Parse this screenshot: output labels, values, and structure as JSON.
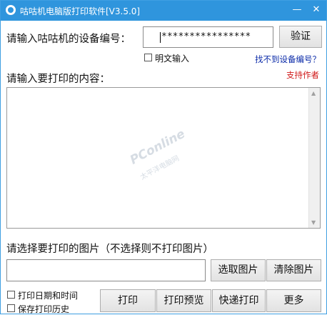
{
  "window": {
    "title": "咕咕机电脑版打印软件[V3.5.0]",
    "minimize_glyph": "—",
    "close_glyph": "✕"
  },
  "device": {
    "label": "请输入咕咕机的设备编号：",
    "value": "****************",
    "verify_label": "验证",
    "show_plain_label": "明文输入",
    "show_plain_checked": false,
    "not_found_link": "找不到设备编号？"
  },
  "content": {
    "label": "请输入要打印的内容：",
    "support_link": "支持作者",
    "text": "",
    "watermark": "PConline",
    "watermark_sub": "太平洋电脑网"
  },
  "image": {
    "label": "请选择要打印的图片（不选择则不打印图片）",
    "path": "",
    "choose_label": "选取图片",
    "clear_label": "清除图片"
  },
  "options": {
    "print_datetime_label": "打印日期和时间",
    "print_datetime_checked": false,
    "save_history_label": "保存打印历史",
    "save_history_checked": false
  },
  "actions": {
    "print_label": "打印",
    "preview_label": "打印预览",
    "quick_print_label": "快递打印",
    "more_label": "更多"
  },
  "colors": {
    "titlebar": "#2f95dd",
    "link_blue": "#0a2aa8",
    "link_red": "#d01818"
  },
  "icons": {
    "app": "app-icon",
    "minimize": "minimize-icon",
    "close": "close-icon",
    "scroll_up": "scroll-up-arrow-icon",
    "scroll_down": "scroll-down-arrow-icon"
  }
}
